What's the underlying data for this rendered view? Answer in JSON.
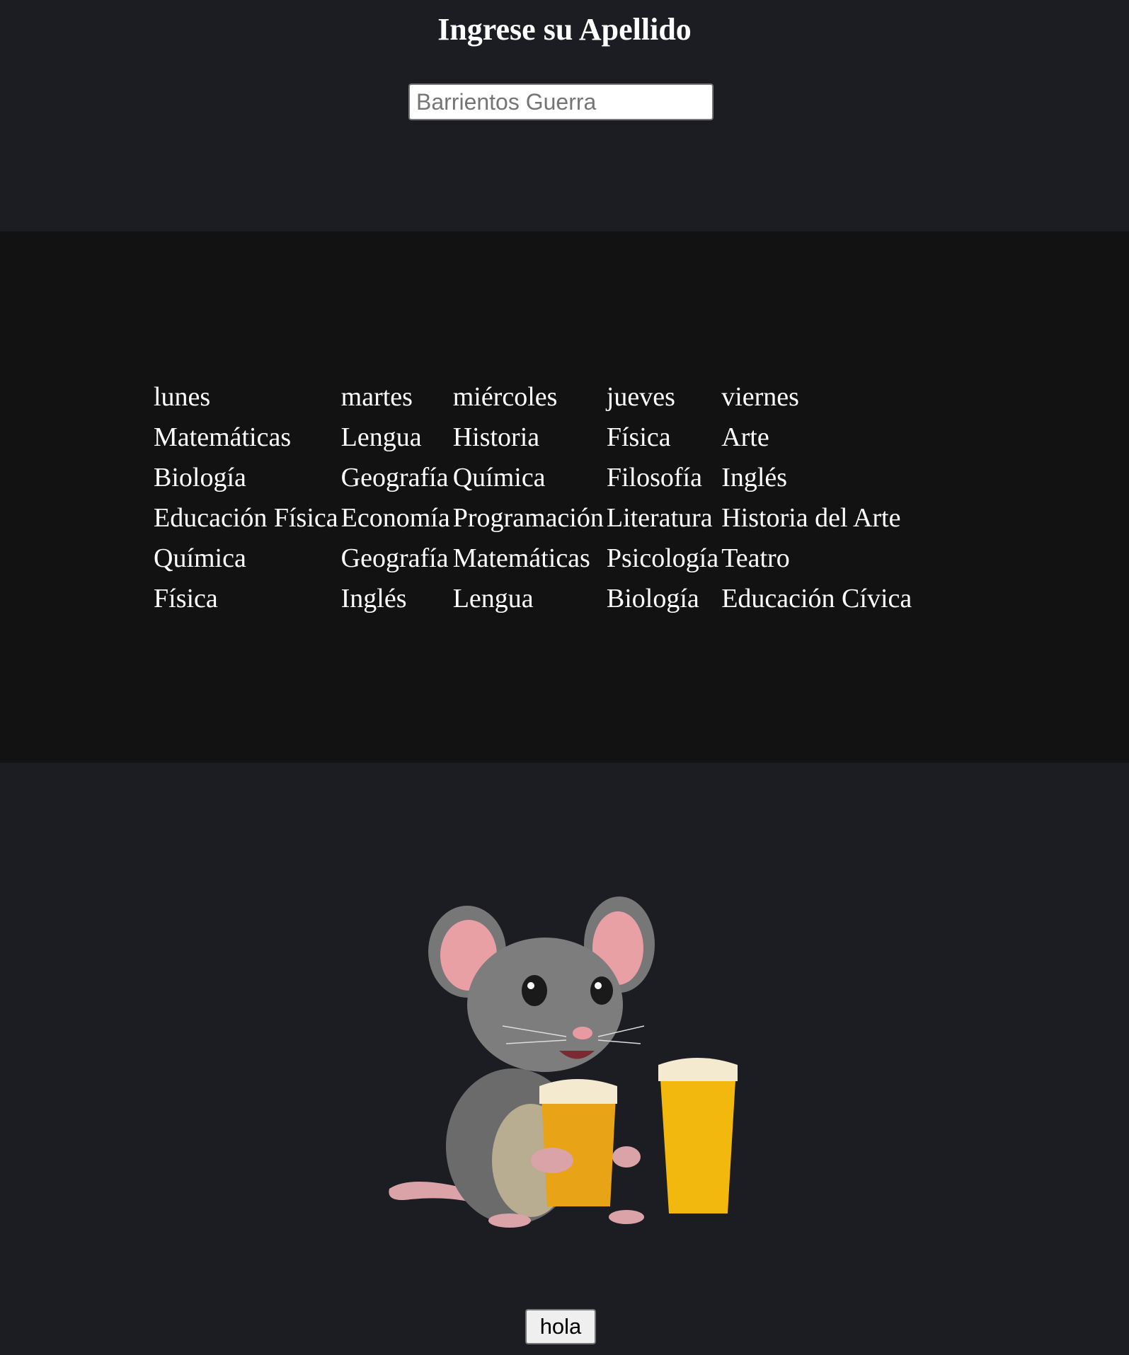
{
  "header": {
    "title": "Ingrese su Apellido"
  },
  "surname_input": {
    "placeholder": "Barrientos Guerra",
    "value": ""
  },
  "schedule": {
    "days": [
      "lunes",
      "martes",
      "miércoles",
      "jueves",
      "viernes"
    ],
    "rows": [
      [
        "Matemáticas",
        "Lengua",
        "Historia",
        "Física",
        "Arte"
      ],
      [
        "Biología",
        "Geografía",
        "Química",
        "Filosofía",
        "Inglés"
      ],
      [
        "Educación Física",
        "Economía",
        "Programación",
        "Literatura",
        "Historia del Arte"
      ],
      [
        "Química",
        "Geografía",
        "Matemáticas",
        "Psicología",
        "Teatro"
      ],
      [
        "Física",
        "Inglés",
        "Lengua",
        "Biología",
        "Educación Cívica"
      ]
    ]
  },
  "image": {
    "icon": "mouse-with-beer-illustration"
  },
  "button": {
    "label": "hola"
  }
}
